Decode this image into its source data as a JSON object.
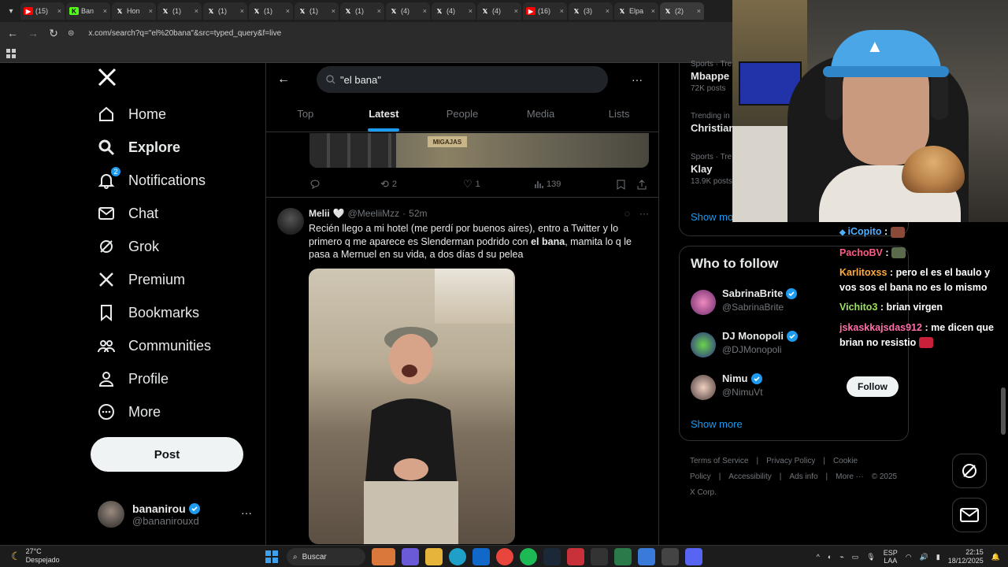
{
  "browser": {
    "tabs": [
      {
        "label": "(15)",
        "icon": "youtube-icon",
        "color": "#ff0000"
      },
      {
        "label": "Ban",
        "icon": "kick-icon",
        "color": "#53fc18"
      },
      {
        "label": "Hon",
        "icon": "x-icon",
        "color": "#000000"
      },
      {
        "label": "(1)",
        "icon": "x-icon",
        "color": "#000000"
      },
      {
        "label": "(1)",
        "icon": "x-icon",
        "color": "#000000"
      },
      {
        "label": "(1)",
        "icon": "x-icon",
        "color": "#000000"
      },
      {
        "label": "(1)",
        "icon": "x-icon",
        "color": "#000000"
      },
      {
        "label": "(1)",
        "icon": "x-icon",
        "color": "#000000"
      },
      {
        "label": "(4)",
        "icon": "x-icon",
        "color": "#000000"
      },
      {
        "label": "(4)",
        "icon": "x-icon",
        "color": "#000000"
      },
      {
        "label": "(4)",
        "icon": "x-icon",
        "color": "#000000"
      },
      {
        "label": "(16)",
        "icon": "youtube-icon",
        "color": "#ff0000"
      },
      {
        "label": "(3)",
        "icon": "x-icon",
        "color": "#000000"
      },
      {
        "label": "Elpa",
        "icon": "x-icon",
        "color": "#000000"
      },
      {
        "label": "(2)",
        "icon": "x-icon",
        "color": "#000000"
      }
    ],
    "url": "x.com/search?q=\"el%20bana\"&src=typed_query&f=live"
  },
  "nav": {
    "items": [
      {
        "label": "Home",
        "icon": "home-icon"
      },
      {
        "label": "Explore",
        "icon": "search-icon",
        "bold": true
      },
      {
        "label": "Notifications",
        "icon": "bell-icon",
        "badge": "2"
      },
      {
        "label": "Chat",
        "icon": "mail-icon"
      },
      {
        "label": "Grok",
        "icon": "grok-icon"
      },
      {
        "label": "Premium",
        "icon": "x-icon"
      },
      {
        "label": "Bookmarks",
        "icon": "bookmark-icon"
      },
      {
        "label": "Communities",
        "icon": "communities-icon"
      },
      {
        "label": "Profile",
        "icon": "profile-icon"
      },
      {
        "label": "More",
        "icon": "more-circle-icon"
      }
    ],
    "post_label": "Post",
    "account": {
      "name": "bananirou",
      "handle": "@bananirouxd"
    }
  },
  "search": {
    "query": "\"el bana\"",
    "tabs": [
      "Top",
      "Latest",
      "People",
      "Media",
      "Lists"
    ],
    "active_tab": "Latest"
  },
  "prev_tweet": {
    "media_text": "MIGAJAS",
    "replies": "",
    "reposts": "2",
    "likes": "1",
    "views": "139"
  },
  "tweet": {
    "name": "Melii",
    "handle": "@MeeliiMzz",
    "time": "52m",
    "text_before": "Recién llego a mi hotel (me perdí por buenos aires), entro a Twitter y lo primero q me aparece es Slenderman podrido con ",
    "text_bold": "el bana",
    "text_after": ", mamita lo q le pasa a Mernuel en su vida, a dos días d su pelea"
  },
  "trends": [
    {
      "category": "Sports · Tre",
      "title": "Mbappe",
      "count": "72K posts"
    },
    {
      "category": "Trending in",
      "title": "Christian",
      "count": ""
    },
    {
      "category": "Sports · Tre",
      "title": "Klay",
      "count": "13.9K posts"
    }
  ],
  "trends_show_more": "Show mo",
  "who_to_follow": {
    "title": "Who to follow",
    "users": [
      {
        "name": "SabrinaBrite",
        "handle": "@SabrinaBrite",
        "verified": true
      },
      {
        "name": "DJ Monopoli",
        "handle": "@DJMonopoli",
        "verified": true
      },
      {
        "name": "Nimu",
        "handle": "@NimuVt",
        "verified": true,
        "button": "Follow"
      }
    ],
    "show_more": "Show more"
  },
  "footer": {
    "links": [
      "Terms of Service",
      "|",
      "Privacy Policy",
      "|",
      "Cookie Policy",
      "|",
      "Accessibility",
      "|",
      "Ads info",
      "|",
      "More ···",
      "© 2025 X Corp."
    ]
  },
  "chat": [
    {
      "user": "iCopito",
      "sep": " :",
      "msg": ""
    },
    {
      "user": "PachoBV",
      "sep": " :",
      "msg": ""
    },
    {
      "user": "Karlitoxss",
      "sep": " :",
      "msg": " pero el es el baulo y vos sos el bana no es lo mismo"
    },
    {
      "user": "Vichito3",
      "sep": " :",
      "msg": " brian virgen"
    },
    {
      "user": "jskaskkajsdas912",
      "sep": " :",
      "msg": " me dicen que brian no resistio"
    }
  ],
  "taskbar": {
    "temp": "27°C",
    "weather": "Despejado",
    "search": "Buscar",
    "lang1": "ESP",
    "lang2": "LAA",
    "time": "22:15",
    "date": "18/12/2025"
  },
  "colors": {
    "accent": "#1d9bf0",
    "background": "#000000"
  }
}
